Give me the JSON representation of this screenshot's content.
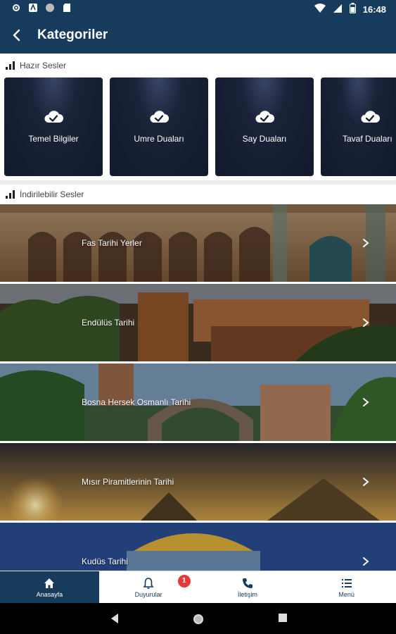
{
  "status_bar": {
    "time": "16:48"
  },
  "app_bar": {
    "title": "Kategoriler"
  },
  "sections": {
    "ready": {
      "title": "Hazır Sesler"
    },
    "downloadable": {
      "title": "İndirilebilir Sesler"
    }
  },
  "ready_cards": [
    {
      "label": "Temel Bilgiler"
    },
    {
      "label": "Umre Duaları"
    },
    {
      "label": "Say Duaları"
    },
    {
      "label": "Tavaf Duaları"
    }
  ],
  "downloadable_rows": [
    {
      "label": "Fas Tarihi Yerler"
    },
    {
      "label": "Endülüs Tarihi"
    },
    {
      "label": "Bosna Hersek Osmanlı Tarihi"
    },
    {
      "label": "Mısır Piramitlerinin Tarihi"
    },
    {
      "label": "Kudüs Tarihi"
    }
  ],
  "bottom_nav": [
    {
      "label": "Anasayfa",
      "icon": "home-icon"
    },
    {
      "label": "Duyurular",
      "icon": "bell-icon",
      "badge": "1"
    },
    {
      "label": "İletişim",
      "icon": "phone-icon"
    },
    {
      "label": "Menü",
      "icon": "menu-icon"
    }
  ],
  "colors": {
    "primary": "#163b5d",
    "badge": "#e53935",
    "card": "#121a2e"
  }
}
